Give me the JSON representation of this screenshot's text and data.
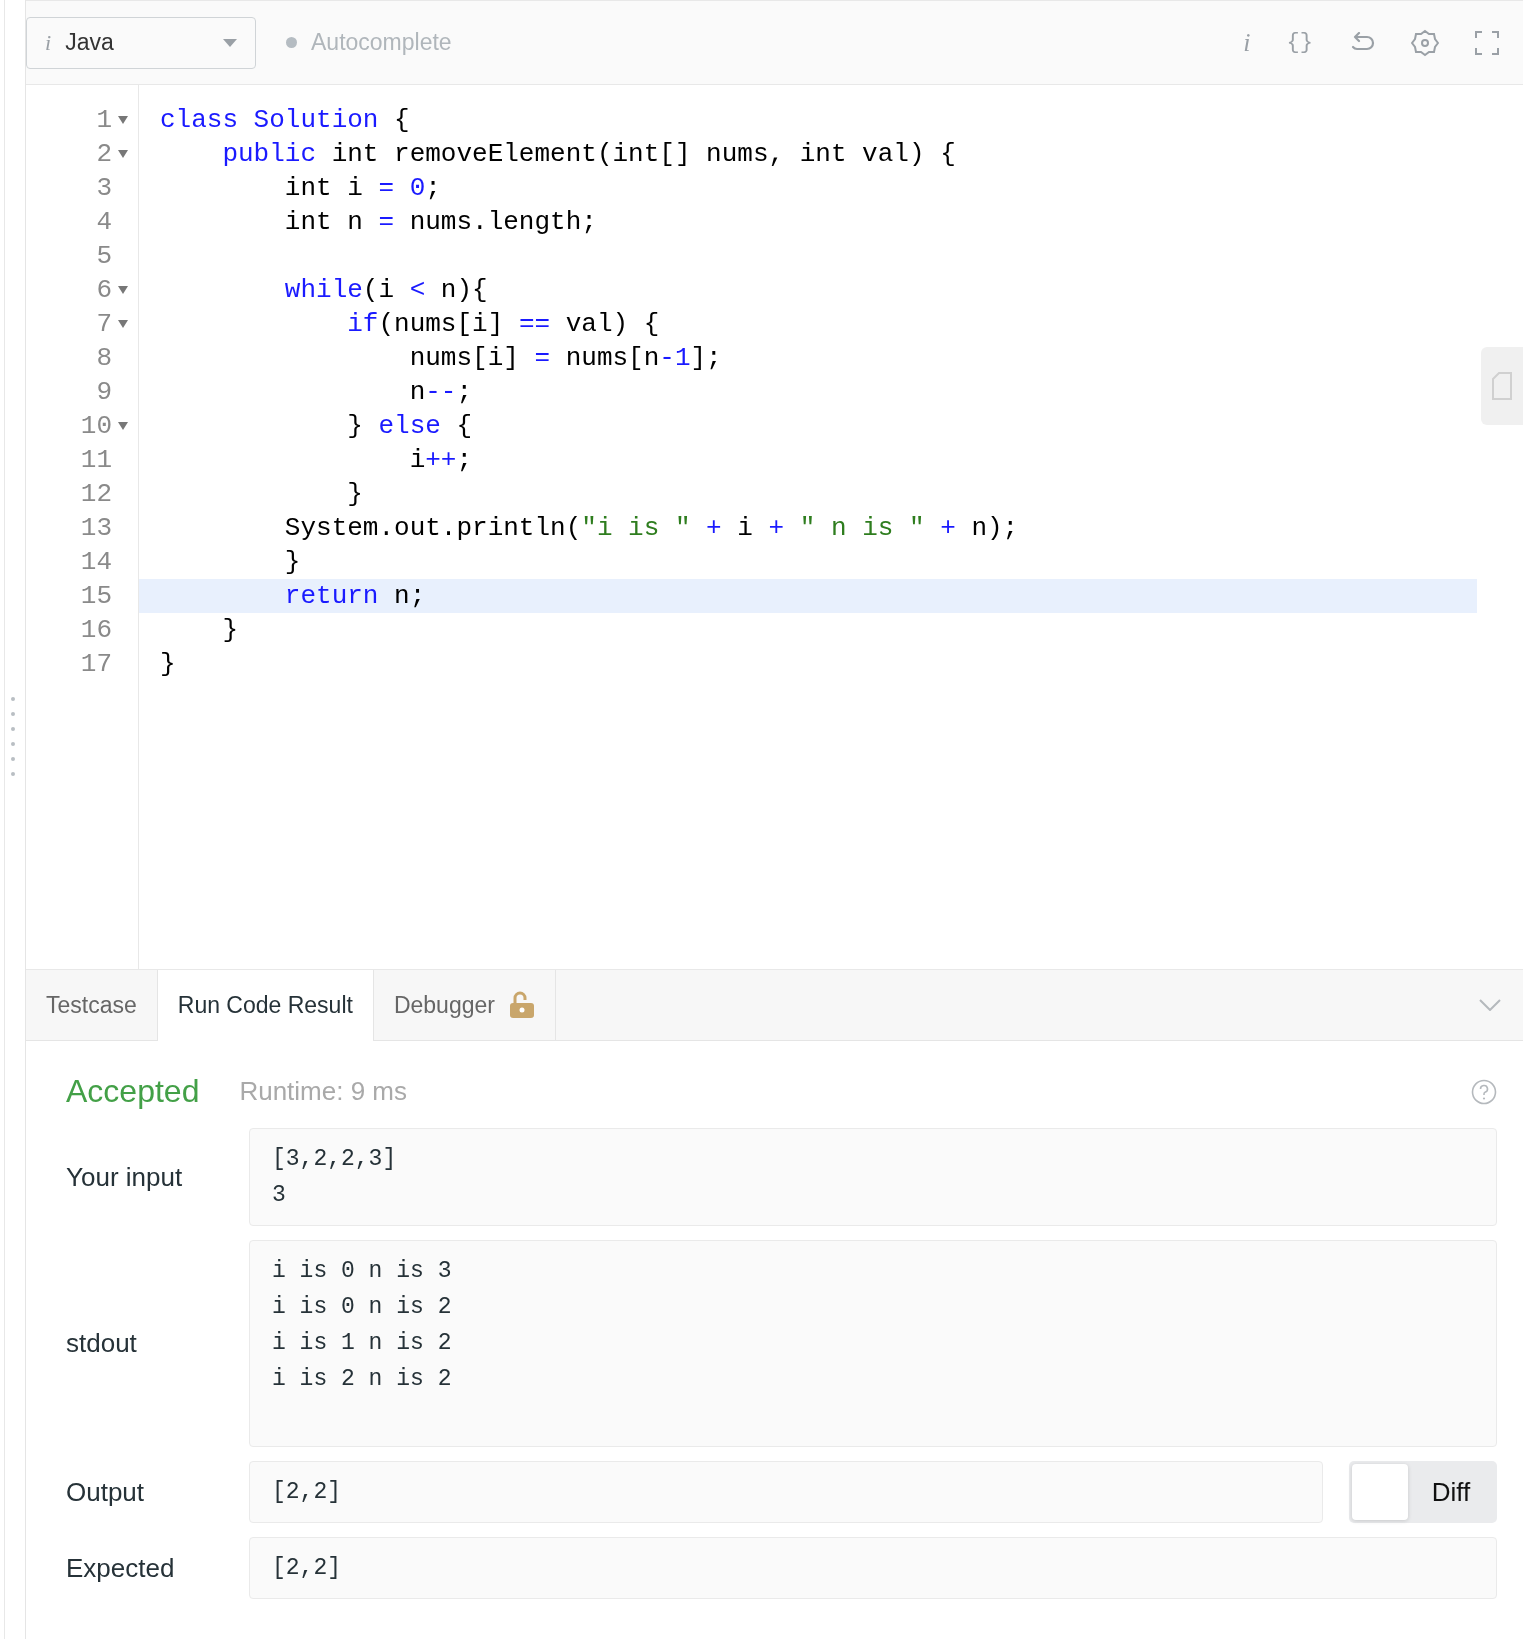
{
  "toolbar": {
    "language_select": {
      "icon_text": "i",
      "value": "Java"
    },
    "autocomplete": {
      "label": "Autocomplete"
    },
    "info_text": "i",
    "braces_text": "{}"
  },
  "editor": {
    "lines": [
      {
        "number": "1",
        "foldable": true,
        "highlighted": false,
        "tokens": [
          {
            "kind": "keyword",
            "text": "class Solution"
          },
          {
            "kind": "plain",
            "text": " {"
          }
        ]
      },
      {
        "number": "2",
        "foldable": true,
        "highlighted": false,
        "tokens": [
          {
            "kind": "keyword",
            "text": "    public"
          },
          {
            "kind": "plain",
            "text": " int removeElement(int[] nums, int val) {"
          }
        ]
      },
      {
        "number": "3",
        "foldable": false,
        "highlighted": false,
        "tokens": [
          {
            "kind": "plain",
            "text": "        int i "
          },
          {
            "kind": "operator",
            "text": "= "
          },
          {
            "kind": "number",
            "text": "0"
          },
          {
            "kind": "plain",
            "text": ";"
          }
        ]
      },
      {
        "number": "4",
        "foldable": false,
        "highlighted": false,
        "tokens": [
          {
            "kind": "plain",
            "text": "        int n "
          },
          {
            "kind": "operator",
            "text": "="
          },
          {
            "kind": "plain",
            "text": " nums.length;"
          }
        ]
      },
      {
        "number": "5",
        "foldable": false,
        "highlighted": false
      },
      {
        "number": "6",
        "foldable": true,
        "highlighted": false,
        "tokens": [
          {
            "kind": "keyword",
            "text": "        while"
          },
          {
            "kind": "plain",
            "text": "(i "
          },
          {
            "kind": "operator",
            "text": "<"
          },
          {
            "kind": "plain",
            "text": " n){"
          }
        ]
      },
      {
        "number": "7",
        "foldable": true,
        "highlighted": false,
        "tokens": [
          {
            "kind": "keyword",
            "text": "            if"
          },
          {
            "kind": "plain",
            "text": "(nums[i] "
          },
          {
            "kind": "operator",
            "text": "=="
          },
          {
            "kind": "plain",
            "text": " val) {"
          }
        ]
      },
      {
        "number": "8",
        "foldable": false,
        "highlighted": false,
        "tokens": [
          {
            "kind": "plain",
            "text": "                nums[i] "
          },
          {
            "kind": "operator",
            "text": "="
          },
          {
            "kind": "plain",
            "text": " nums[n"
          },
          {
            "kind": "operator",
            "text": "-"
          },
          {
            "kind": "number",
            "text": "1"
          },
          {
            "kind": "plain",
            "text": "];"
          }
        ]
      },
      {
        "number": "9",
        "foldable": false,
        "highlighted": false,
        "tokens": [
          {
            "kind": "plain",
            "text": "                n"
          },
          {
            "kind": "operator",
            "text": "--"
          },
          {
            "kind": "plain",
            "text": ";"
          }
        ]
      },
      {
        "number": "10",
        "foldable": true,
        "highlighted": false,
        "tokens": [
          {
            "kind": "plain",
            "text": "            } "
          },
          {
            "kind": "keyword",
            "text": "else"
          },
          {
            "kind": "plain",
            "text": " {"
          }
        ]
      },
      {
        "number": "11",
        "foldable": false,
        "highlighted": false,
        "tokens": [
          {
            "kind": "plain",
            "text": "                i"
          },
          {
            "kind": "operator",
            "text": "++"
          },
          {
            "kind": "plain",
            "text": ";"
          }
        ]
      },
      {
        "number": "12",
        "foldable": false,
        "highlighted": false,
        "tokens": [
          {
            "kind": "plain",
            "text": "            }"
          }
        ]
      },
      {
        "number": "13",
        "foldable": false,
        "highlighted": false,
        "tokens": [
          {
            "kind": "plain",
            "text": "        System.out.println("
          },
          {
            "kind": "string",
            "text": "\"i is \""
          },
          {
            "kind": "operator",
            "text": " + "
          },
          {
            "kind": "plain",
            "text": "i"
          },
          {
            "kind": "operator",
            "text": " + "
          },
          {
            "kind": "string",
            "text": "\" n is \""
          },
          {
            "kind": "operator",
            "text": " + "
          },
          {
            "kind": "plain",
            "text": "n);"
          }
        ]
      },
      {
        "number": "14",
        "foldable": false,
        "highlighted": false,
        "tokens": [
          {
            "kind": "plain",
            "text": "        }"
          }
        ]
      },
      {
        "number": "15",
        "foldable": false,
        "highlighted": true,
        "tokens": [
          {
            "kind": "keyword",
            "text": "        return"
          },
          {
            "kind": "plain",
            "text": " n;"
          }
        ]
      },
      {
        "number": "16",
        "foldable": false,
        "highlighted": false,
        "tokens": [
          {
            "kind": "plain",
            "text": "    }"
          }
        ]
      },
      {
        "number": "17",
        "foldable": false,
        "highlighted": false,
        "tokens": [
          {
            "kind": "plain",
            "text": "}"
          }
        ]
      }
    ]
  },
  "tabs": [
    {
      "label": "Testcase",
      "selected": false
    },
    {
      "label": "Run Code Result",
      "selected": true
    },
    {
      "label": "Debugger",
      "selected": false,
      "locked_icon": true
    }
  ],
  "result": {
    "status": "Accepted",
    "runtime": "Runtime: 9 ms",
    "rows": [
      {
        "label": "Your input",
        "lines": [
          "[3,2,2,3]",
          "3"
        ],
        "tall": false
      },
      {
        "label": "stdout",
        "lines": [
          "i is 0 n is 3",
          "i is 0 n is 2",
          "i is 1 n is 2",
          "i is 2 n is 2"
        ],
        "tall": true
      },
      {
        "label": "Output",
        "lines": [
          "[2,2]"
        ],
        "tall": false,
        "diff_toggle": {
          "label": "Diff",
          "on": false
        }
      },
      {
        "label": "Expected",
        "lines": [
          "[2,2]"
        ],
        "tall": false
      }
    ]
  }
}
